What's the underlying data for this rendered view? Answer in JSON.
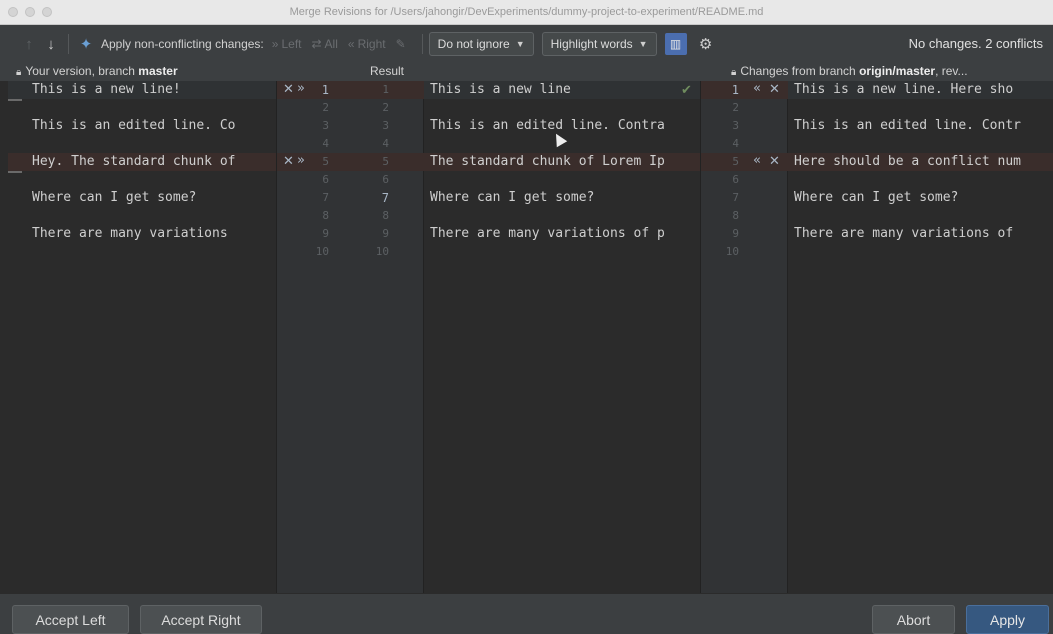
{
  "window": {
    "title": "Merge Revisions for /Users/jahongir/DevExperiments/dummy-project-to-experiment/README.md"
  },
  "toolbar": {
    "apply_label": "Apply non-conflicting changes:",
    "left_label": "Left",
    "all_label": "All",
    "right_label": "Right",
    "ignore_select": "Do not ignore",
    "highlight_select": "Highlight words",
    "status": "No changes. 2 conflicts"
  },
  "headers": {
    "left_prefix": "Your version, branch ",
    "left_branch": "master",
    "middle": "Result",
    "right_prefix": "Changes from branch ",
    "right_branch": "origin/master",
    "right_suffix": ", rev..."
  },
  "left_lines": [
    "This is a new line!",
    "This is an edited line. Co",
    "Hey. The standard chunk of",
    "Where can I get some?",
    "There are many variations "
  ],
  "middle_lines": [
    "This is a new line",
    "This is an edited line. Contra",
    "The standard chunk of Lorem Ip",
    "Where can I get some?",
    "There are many variations of p"
  ],
  "right_lines": [
    "This is a new line. Here sho",
    "This is an edited line. Contr",
    "Here should be a conflict num",
    "Where can I get some?",
    "There are many variations of"
  ],
  "gutter": {
    "left_numbers": [
      "1",
      "2",
      "3",
      "4",
      "5",
      "6",
      "7",
      "8",
      "9",
      "10"
    ],
    "mid_numbers": [
      "1",
      "2",
      "3",
      "4",
      "5",
      "6",
      "7",
      "8",
      "9",
      "10"
    ],
    "right_numbers": [
      "1",
      "2",
      "3",
      "4",
      "5",
      "6",
      "7",
      "8",
      "9",
      "10"
    ]
  },
  "buttons": {
    "accept_left": "Accept Left",
    "accept_right": "Accept Right",
    "abort": "Abort",
    "apply": "Apply"
  },
  "colors": {
    "accent": "#365880",
    "conflict_bg": "#3a2d2b",
    "resolved_check": "#499c54"
  }
}
